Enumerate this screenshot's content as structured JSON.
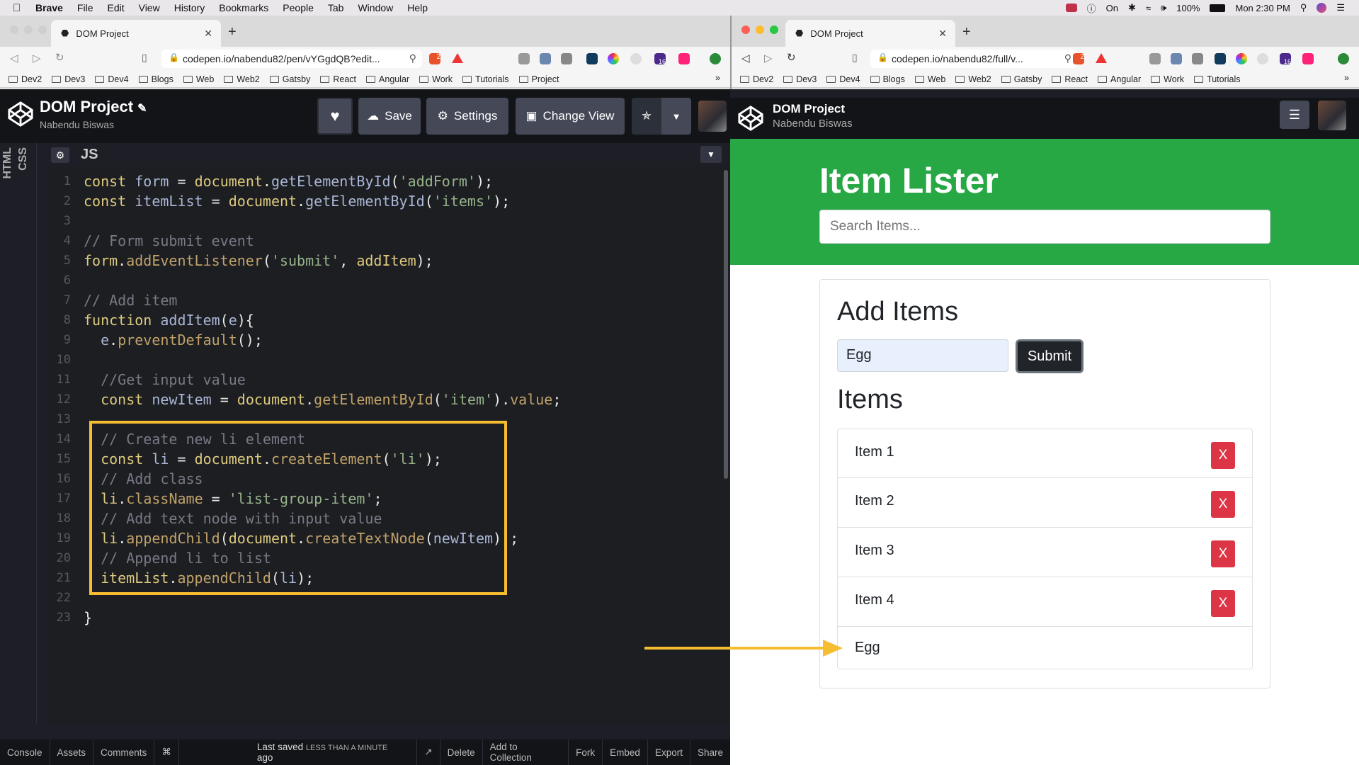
{
  "menubar": {
    "app": "Brave",
    "items": [
      "File",
      "Edit",
      "View",
      "History",
      "Bookmarks",
      "People",
      "Tab",
      "Window",
      "Help"
    ],
    "focus_status": "On",
    "battery": "100%",
    "clock": "Mon 2:30 PM"
  },
  "left_window": {
    "tab_title": "DOM Project",
    "url": "codepen.io/nabendu82/pen/vYGgdQB?edit...",
    "brave_badge": "2",
    "ext_badge": "16",
    "bookmarks": [
      "Dev2",
      "Dev3",
      "Dev4",
      "Blogs",
      "Web",
      "Web2",
      "Gatsby",
      "React",
      "Angular",
      "Work",
      "Tutorials",
      "Project"
    ],
    "bookmarks_more": "»"
  },
  "right_window": {
    "tab_title": "DOM Project",
    "url": "codepen.io/nabendu82/full/v...",
    "brave_badge": "2",
    "ext_badge": "16",
    "bookmarks": [
      "Dev2",
      "Dev3",
      "Dev4",
      "Blogs",
      "Web",
      "Web2",
      "Gatsby",
      "React",
      "Angular",
      "Work",
      "Tutorials"
    ],
    "bookmarks_more": "»"
  },
  "codepen": {
    "project_title": "DOM Project",
    "author": "Nabendu Biswas",
    "buttons": {
      "save": "Save",
      "settings": "Settings",
      "change_view": "Change View"
    },
    "sidebar_tabs": [
      "CSS",
      "HTML"
    ],
    "editor_label": "JS",
    "footer": {
      "console": "Console",
      "assets": "Assets",
      "comments": "Comments",
      "shortcuts": "⌘",
      "saved_prefix": "Last saved",
      "saved_time": "LESS THAN A MINUTE",
      "saved_suffix": "ago",
      "delete": "Delete",
      "add_to_collection": "Add to Collection",
      "fork": "Fork",
      "embed": "Embed",
      "export": "Export",
      "share": "Share"
    }
  },
  "code_lines": [
    "const form = document.getElementById('addForm');",
    "const itemList = document.getElementById('items');",
    "",
    "// Form submit event",
    "form.addEventListener('submit', addItem);",
    "",
    "// Add item",
    "function addItem(e){",
    "  e.preventDefault();",
    "",
    "  //Get input value",
    "  const newItem = document.getElementById('item').value;",
    "",
    "  // Create new li element",
    "  const li = document.createElement('li');",
    "  // Add class",
    "  li.className = 'list-group-item';",
    "  // Add text node with input value",
    "  li.appendChild(document.createTextNode(newItem));",
    "  // Append li to list",
    "  itemList.appendChild(li);",
    "",
    "}"
  ],
  "preview": {
    "project_title": "DOM Project",
    "author": "Nabendu Biswas",
    "heading": "Item Lister",
    "search_placeholder": "Search Items...",
    "add_heading": "Add Items",
    "input_value": "Egg",
    "submit": "Submit",
    "items_heading": "Items",
    "items": [
      {
        "label": "Item 1",
        "delete": "X"
      },
      {
        "label": "Item 2",
        "delete": "X"
      },
      {
        "label": "Item 3",
        "delete": "X"
      },
      {
        "label": "Item 4",
        "delete": "X"
      },
      {
        "label": "Egg"
      }
    ]
  },
  "colors": {
    "highlight": "#f6bd31",
    "green": "#28a745",
    "danger": "#dc3545",
    "editor_bg": "#1d1e22"
  }
}
